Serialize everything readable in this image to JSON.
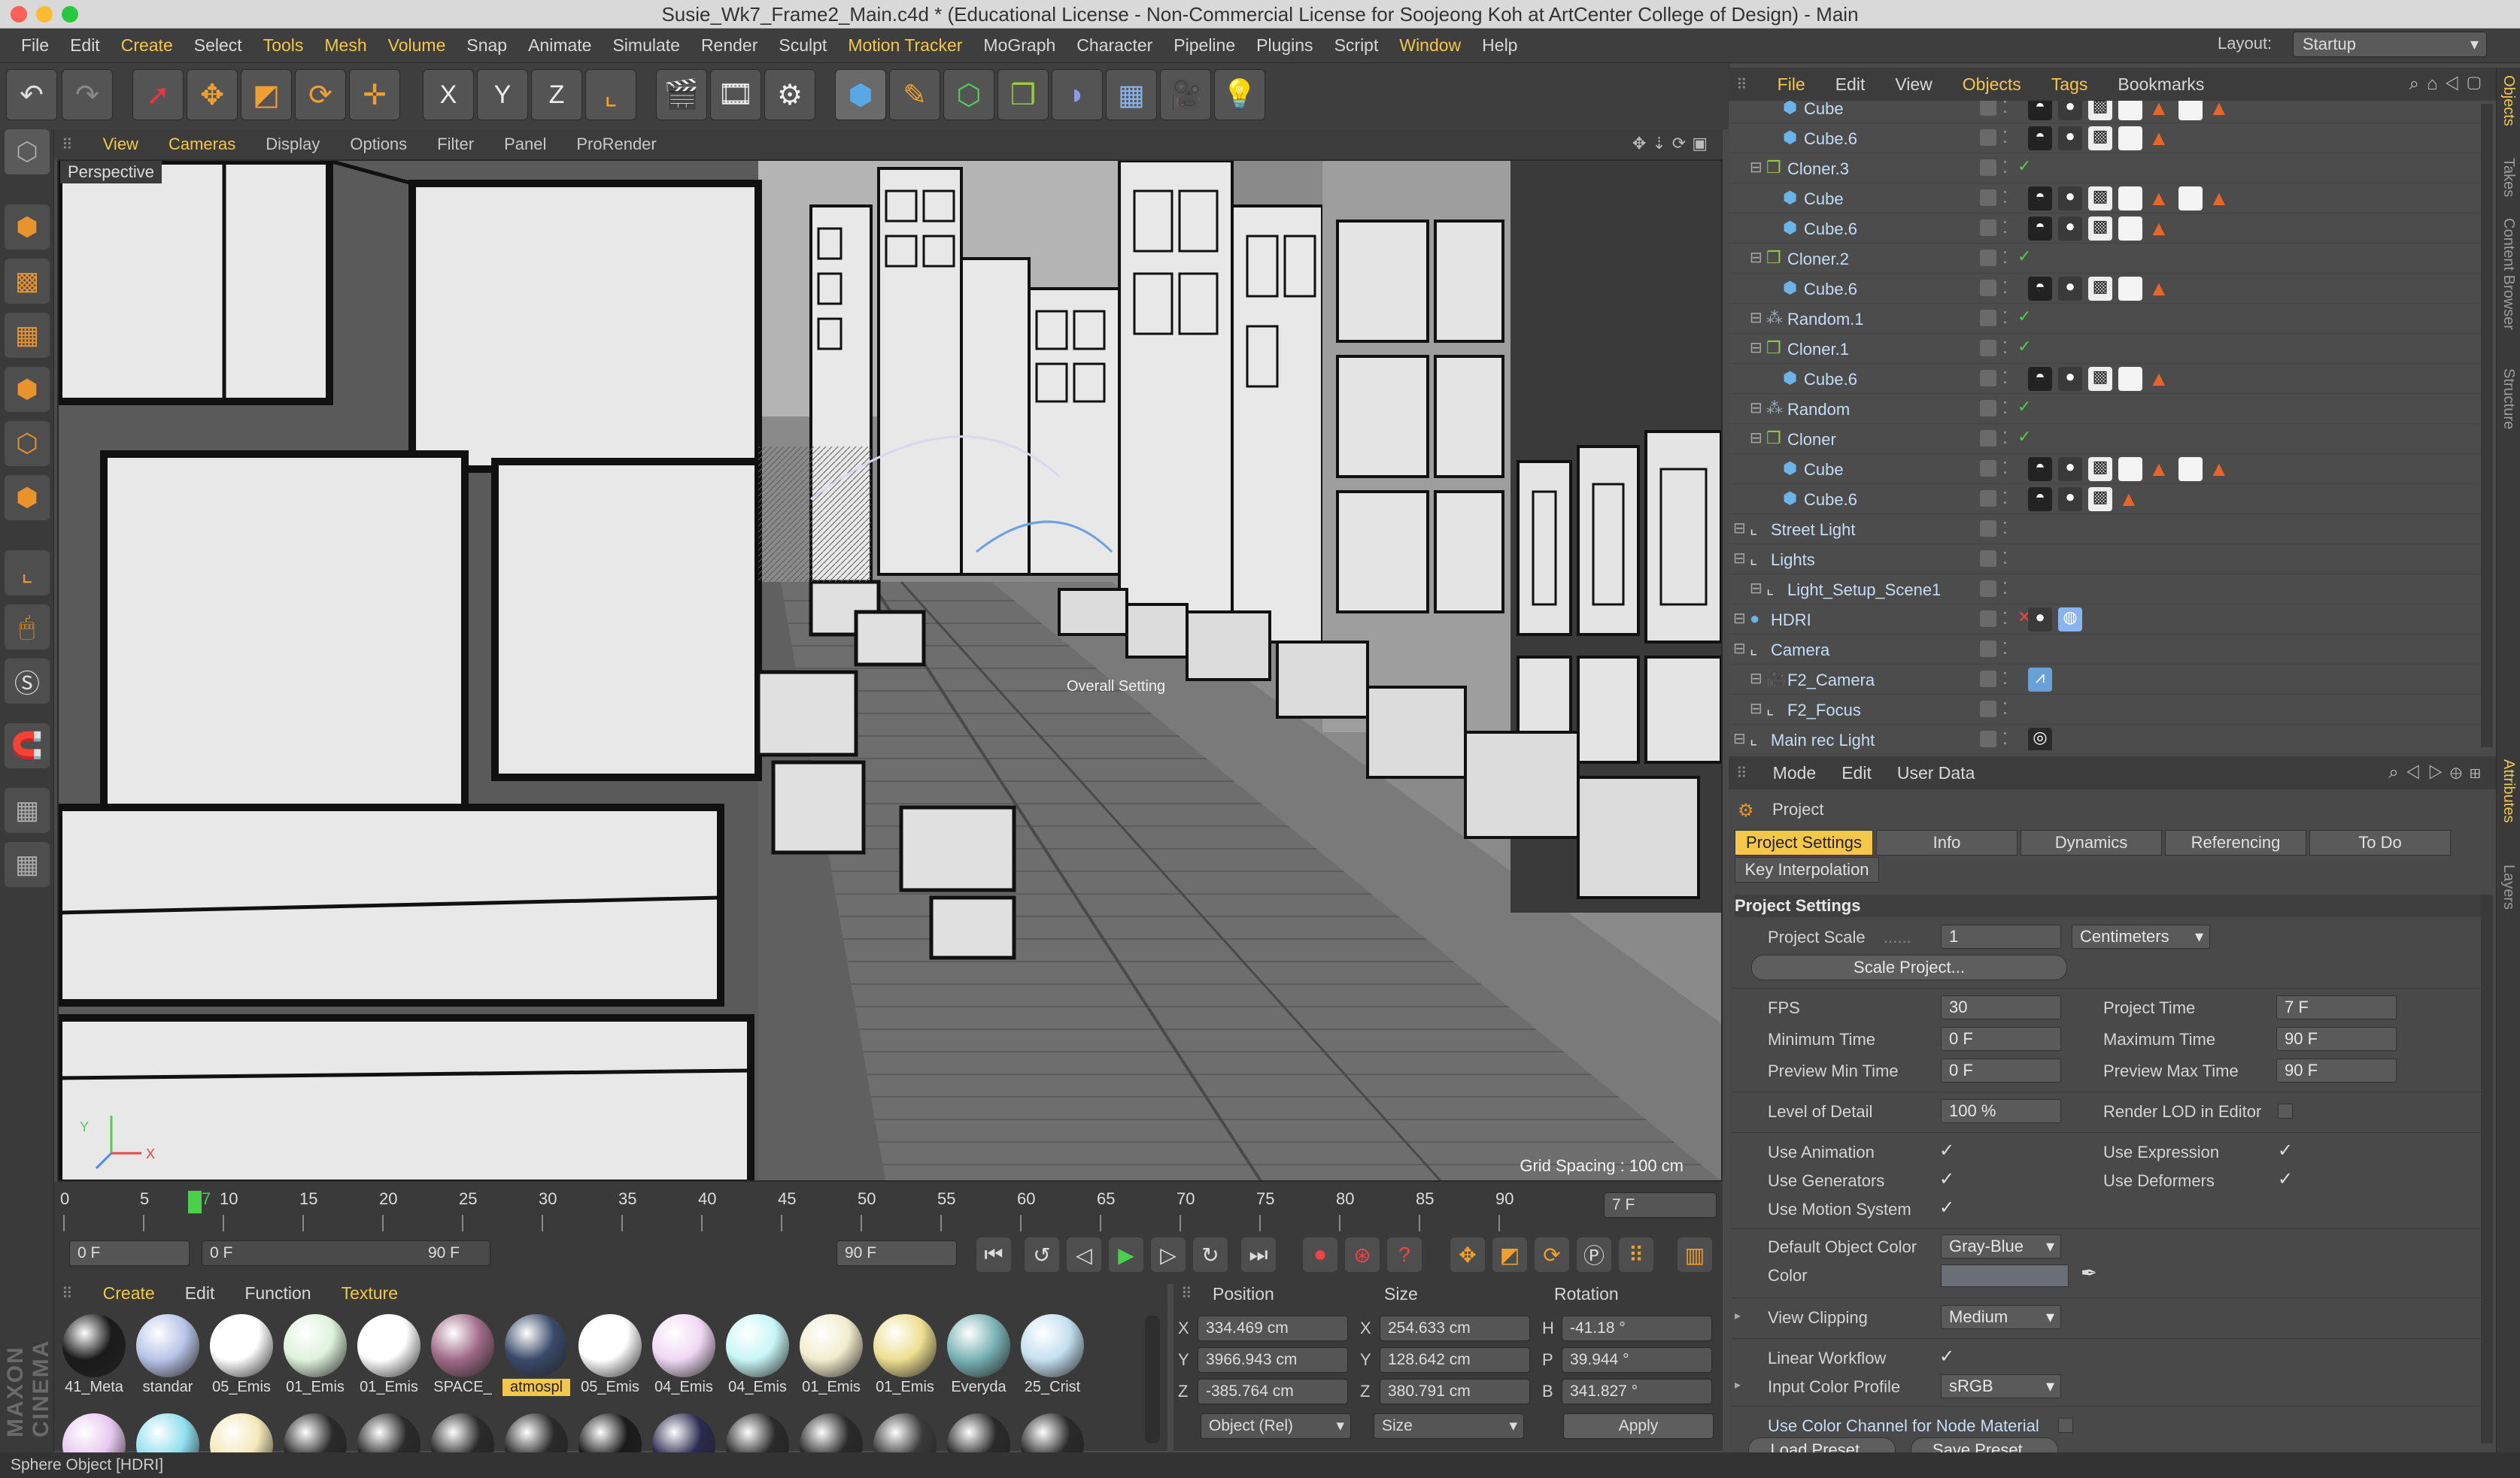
{
  "window": {
    "title": "Susie_Wk7_Frame2_Main.c4d * (Educational License - Non-Commercial License for Soojeong Koh at ArtCenter College of Design) - Main"
  },
  "menu": [
    "File",
    "Edit",
    "Create",
    "Select",
    "Tools",
    "Mesh",
    "Volume",
    "Snap",
    "Animate",
    "Simulate",
    "Render",
    "Sculpt",
    "Motion Tracker",
    "MoGraph",
    "Character",
    "Pipeline",
    "Plugins",
    "Script",
    "Window",
    "Help"
  ],
  "menu_highlight": [
    "Create",
    "Tools",
    "Mesh",
    "Volume",
    "Motion Tracker",
    "Window"
  ],
  "layout": {
    "label": "Layout:",
    "value": "Startup"
  },
  "toolbar": {
    "x": "X",
    "y": "Y",
    "z": "Z"
  },
  "viewport": {
    "menu": [
      "View",
      "Cameras",
      "Display",
      "Options",
      "Filter",
      "Panel",
      "ProRender"
    ],
    "menu_highlight": [
      "View",
      "Cameras"
    ],
    "label": "Perspective",
    "grid_spacing": "Grid Spacing : 100 cm",
    "overlay_label": "Overall Setting",
    "axis_y": "Y",
    "axis_x": "X"
  },
  "timeline": {
    "ticks": [
      "0",
      "5",
      "10",
      "15",
      "20",
      "25",
      "30",
      "35",
      "40",
      "45",
      "50",
      "55",
      "60",
      "65",
      "70",
      "75",
      "80",
      "85",
      "90"
    ],
    "current": "7",
    "current_field": "7 F"
  },
  "transport": {
    "start": "0 F",
    "range_start": "0 F",
    "range_end": "90 F",
    "end": "90 F"
  },
  "materials": {
    "menu": [
      "Create",
      "Edit",
      "Function",
      "Texture"
    ],
    "menu_highlight": [
      "Create",
      "Texture"
    ],
    "items": [
      "41_Meta",
      "standar",
      "05_Emis",
      "01_Emis",
      "01_Emis",
      "SPACE_",
      "atmospl",
      "05_Emis",
      "04_Emis",
      "04_Emis",
      "01_Emis",
      "01_Emis",
      "Everyda",
      "25_Crist"
    ],
    "selected": "atmospl",
    "colors": [
      "#1a1a1a",
      "#b8c4e8",
      "#ffffff",
      "#dff3dc",
      "#ffffff",
      "#a06a88",
      "#3a4a6a",
      "#ffffff",
      "#f0d8f4",
      "#c8f6f6",
      "#f2edce",
      "#eedf90",
      "#7ab3b6",
      "#c4e0f0"
    ],
    "row2_colors": [
      "#e8c8f0",
      "#90e0f0",
      "#f4e8b8",
      "#2a2a2a",
      "#2a2a2a",
      "#2a2a2a",
      "#2a2a2a",
      "#1a1a1a",
      "#2a2a50",
      "#2a2a2a",
      "#2a2a2a",
      "#3a3a3a",
      "#2a2a2a",
      "#2a2a2a"
    ]
  },
  "coordinates": {
    "headers": [
      "Position",
      "Size",
      "Rotation"
    ],
    "rows": [
      {
        "a": "X",
        "pos": "334.469 cm",
        "b": "X",
        "size": "254.633 cm",
        "c": "H",
        "rot": "-41.18 °"
      },
      {
        "a": "Y",
        "pos": "3966.943 cm",
        "b": "Y",
        "size": "128.642 cm",
        "c": "P",
        "rot": "39.944 °"
      },
      {
        "a": "Z",
        "pos": "-385.764 cm",
        "b": "Z",
        "size": "380.791 cm",
        "c": "B",
        "rot": "341.827 °"
      }
    ],
    "mode": "Object (Rel)",
    "size_mode": "Size",
    "apply": "Apply"
  },
  "object_manager": {
    "menu": [
      "File",
      "Edit",
      "View",
      "Objects",
      "Tags",
      "Bookmarks"
    ],
    "menu_highlight": [
      "File",
      "Objects",
      "Tags"
    ],
    "objects": [
      {
        "name": "Cube",
        "indent": 2,
        "kind": "cube",
        "tags": [
          "phong",
          "ball",
          "check",
          "white",
          "orange",
          "white",
          "orange"
        ]
      },
      {
        "name": "Cube.6",
        "indent": 2,
        "kind": "cube",
        "tags": [
          "phong",
          "ball",
          "check",
          "white",
          "orange"
        ]
      },
      {
        "name": "Cloner.3",
        "indent": 1,
        "kind": "cloner",
        "tags": []
      },
      {
        "name": "Cube",
        "indent": 2,
        "kind": "cube",
        "tags": [
          "phong",
          "ball",
          "check",
          "white",
          "orange",
          "white",
          "orange"
        ]
      },
      {
        "name": "Cube.6",
        "indent": 2,
        "kind": "cube",
        "tags": [
          "phong",
          "ball",
          "check",
          "white",
          "orange"
        ]
      },
      {
        "name": "Cloner.2",
        "indent": 1,
        "kind": "cloner",
        "tags": []
      },
      {
        "name": "Cube.6",
        "indent": 2,
        "kind": "cube",
        "tags": [
          "phong",
          "ball",
          "check",
          "white",
          "orange"
        ]
      },
      {
        "name": "Random.1",
        "indent": 1,
        "kind": "random",
        "tags": []
      },
      {
        "name": "Cloner.1",
        "indent": 1,
        "kind": "cloner",
        "tags": []
      },
      {
        "name": "Cube.6",
        "indent": 2,
        "kind": "cube",
        "tags": [
          "phong",
          "ball",
          "check",
          "white",
          "orange"
        ]
      },
      {
        "name": "Random",
        "indent": 1,
        "kind": "random",
        "tags": []
      },
      {
        "name": "Cloner",
        "indent": 1,
        "kind": "cloner",
        "tags": []
      },
      {
        "name": "Cube",
        "indent": 2,
        "kind": "cube",
        "tags": [
          "phong",
          "ball",
          "check",
          "white",
          "orange",
          "white",
          "orange"
        ]
      },
      {
        "name": "Cube.6",
        "indent": 2,
        "kind": "cube",
        "tags": [
          "phong",
          "ball",
          "check",
          "orange"
        ]
      },
      {
        "name": "Street Light",
        "indent": 0,
        "kind": "null",
        "tags": []
      },
      {
        "name": "Lights",
        "indent": 0,
        "kind": "null",
        "tags": []
      },
      {
        "name": "Light_Setup_Scene1",
        "indent": 1,
        "kind": "null",
        "tags": []
      },
      {
        "name": "HDRI",
        "indent": 0,
        "kind": "sphere",
        "tags": [
          "ball",
          "sky"
        ]
      },
      {
        "name": "Camera",
        "indent": 0,
        "kind": "null",
        "tags": []
      },
      {
        "name": "F2_Camera",
        "indent": 1,
        "kind": "camera",
        "tags": [
          "target"
        ]
      },
      {
        "name": "F2_Focus",
        "indent": 1,
        "kind": "null",
        "tags": []
      },
      {
        "name": "Main rec Light",
        "indent": 0,
        "kind": "null",
        "tags": [
          "dark"
        ]
      }
    ]
  },
  "attributes": {
    "menu": [
      "Mode",
      "Edit",
      "User Data"
    ],
    "object": "Project",
    "tabs": [
      "Project Settings",
      "Info",
      "Dynamics",
      "Referencing",
      "To Do"
    ],
    "tab_active": "Project Settings",
    "tab2": "Key Interpolation",
    "section": "Project Settings",
    "project_scale_label": "Project Scale",
    "project_scale": "1",
    "units": "Centimeters",
    "scale_btn": "Scale Project...",
    "fps_label": "FPS",
    "fps": "30",
    "project_time_label": "Project Time",
    "project_time": "7 F",
    "min_time_label": "Minimum Time",
    "min_time": "0 F",
    "max_time_label": "Maximum Time",
    "max_time": "90 F",
    "prev_min_label": "Preview Min Time",
    "prev_min": "0 F",
    "prev_max_label": "Preview Max Time",
    "prev_max": "90 F",
    "lod_label": "Level of Detail",
    "lod": "100 %",
    "render_lod_label": "Render LOD in Editor",
    "use_anim": "Use Animation",
    "use_expr": "Use Expression",
    "use_gen": "Use Generators",
    "use_def": "Use Deformers",
    "use_motion": "Use Motion System",
    "def_color_label": "Default Object Color",
    "def_color": "Gray-Blue",
    "color_label": "Color",
    "clipping_label": "View Clipping",
    "clipping": "Medium",
    "linear_label": "Linear Workflow",
    "input_profile_label": "Input Color Profile",
    "input_profile": "sRGB",
    "node_label": "Use Color Channel for Node Material",
    "load_preset": "Load Preset...",
    "save_preset": "Save Preset..."
  },
  "side_tabs": [
    "Objects",
    "Takes",
    "Content Browser",
    "Structure"
  ],
  "side_tabs2": [
    "Attributes",
    "Layers"
  ],
  "status": "Sphere Object [HDRI]",
  "brand": "MAXON CINEMA 4D"
}
